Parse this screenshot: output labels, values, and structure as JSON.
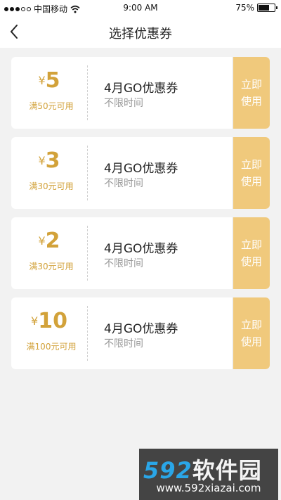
{
  "status_bar": {
    "carrier": "中国移动",
    "time": "9:00 AM",
    "battery_percent_label": "75%",
    "battery_level": 0.75
  },
  "nav": {
    "title": "选择优惠券"
  },
  "coupons": [
    {
      "currency": "¥",
      "amount": "5",
      "condition": "满50元可用",
      "name": "4月GO优惠券",
      "validity": "不限时间",
      "action": "立即使用"
    },
    {
      "currency": "¥",
      "amount": "3",
      "condition": "满30元可用",
      "name": "4月GO优惠券",
      "validity": "不限时间",
      "action": "立即使用"
    },
    {
      "currency": "¥",
      "amount": "2",
      "condition": "满30元可用",
      "name": "4月GO优惠券",
      "validity": "不限时间",
      "action": "立即使用"
    },
    {
      "currency": "¥",
      "amount": "10",
      "condition": "满100元可用",
      "name": "4月GO优惠券",
      "validity": "不限时间",
      "action": "立即使用"
    }
  ],
  "watermark": {
    "logo_digits": "592",
    "logo_text": "软件园",
    "url": "www.592xiazai.com"
  },
  "colors": {
    "accent": "#d2a23a",
    "button": "#f0c97c",
    "background": "#f2f2f2"
  }
}
